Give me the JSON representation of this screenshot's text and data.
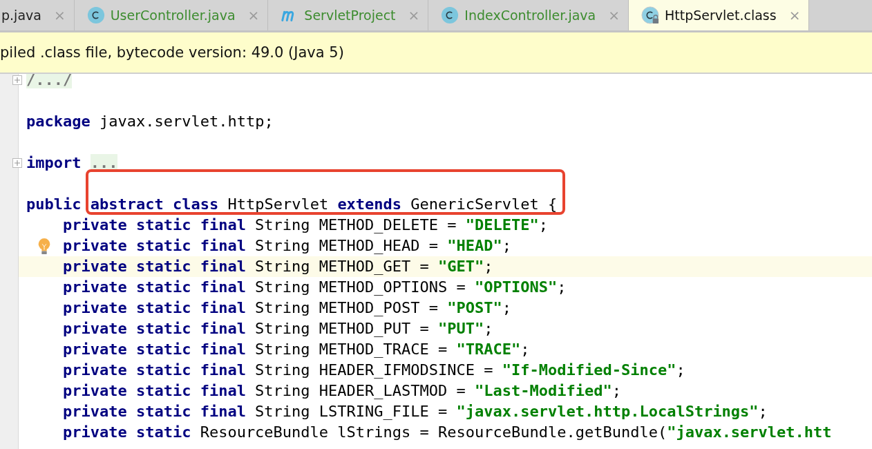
{
  "tabs": [
    {
      "label": "p.java",
      "kind": "plain",
      "close": "×",
      "color": "#222222",
      "selected": false
    },
    {
      "label": "UserController.java",
      "kind": "class",
      "close": "×",
      "color": "#3d8c2f",
      "selected": false
    },
    {
      "label": "ServletProject",
      "kind": "module",
      "close": "×",
      "color": "#3d8c2f",
      "selected": false
    },
    {
      "label": "IndexController.java",
      "kind": "class",
      "close": "×",
      "color": "#3d8c2f",
      "selected": false
    },
    {
      "label": "HttpServlet.class",
      "kind": "locked-class",
      "close": "×",
      "color": "#111111",
      "selected": true
    }
  ],
  "banner": {
    "text": "piled .class file, bytecode version: 49.0 (Java 5)"
  },
  "code_lines": [
    {
      "kind": "code",
      "fold": true,
      "tokens": [
        {
          "kind": "folded",
          "text": "/.../"
        }
      ]
    },
    {
      "kind": "blank"
    },
    {
      "kind": "code",
      "tokens": [
        {
          "kind": "keyword",
          "text": "package"
        },
        {
          "kind": "plain",
          "text": " javax.servlet.http;"
        }
      ]
    },
    {
      "kind": "blank"
    },
    {
      "kind": "code",
      "fold": true,
      "tokens": [
        {
          "kind": "keyword",
          "text": "import"
        },
        {
          "kind": "folded",
          "text": "..."
        }
      ]
    },
    {
      "kind": "blank"
    },
    {
      "kind": "code",
      "tokens": [
        {
          "kind": "keyword",
          "text": "public"
        },
        {
          "kind": "keyword",
          "text": "abstract",
          "boxed": true
        },
        {
          "kind": "keyword",
          "text": " class",
          "boxed": true
        },
        {
          "kind": "plain",
          "text": " HttpServlet ",
          "boxed": true
        },
        {
          "kind": "keyword",
          "text": "extends",
          "boxed": true
        },
        {
          "kind": "plain",
          "text": " GenericServlet {",
          "boxed": true
        }
      ]
    },
    {
      "kind": "code",
      "indented": true,
      "tokens": [
        {
          "kind": "keyword",
          "text": "private static final"
        },
        {
          "kind": "plain",
          "text": " String METHOD_DELETE = "
        },
        {
          "kind": "string",
          "text": "\"DELETE\""
        },
        {
          "kind": "plain",
          "text": ";"
        }
      ]
    },
    {
      "kind": "code",
      "indented": true,
      "bulb": true,
      "tokens": [
        {
          "kind": "keyword",
          "text": "private static final"
        },
        {
          "kind": "plain",
          "text": " String METHOD_HEAD = "
        },
        {
          "kind": "string",
          "text": "\"HEAD\""
        },
        {
          "kind": "plain",
          "text": ";"
        }
      ]
    },
    {
      "kind": "code",
      "indented": true,
      "current": true,
      "tokens": [
        {
          "kind": "keyword",
          "text": "private static final"
        },
        {
          "kind": "plain",
          "text": " String METHOD_GET = "
        },
        {
          "kind": "string",
          "text": "\"GET\""
        },
        {
          "kind": "plain",
          "text": ";"
        }
      ]
    },
    {
      "kind": "code",
      "indented": true,
      "tokens": [
        {
          "kind": "keyword",
          "text": "private static final"
        },
        {
          "kind": "plain",
          "text": " String METHOD_OPTIONS = "
        },
        {
          "kind": "string",
          "text": "\"OPTIONS\""
        },
        {
          "kind": "plain",
          "text": ";"
        }
      ]
    },
    {
      "kind": "code",
      "indented": true,
      "tokens": [
        {
          "kind": "keyword",
          "text": "private static final"
        },
        {
          "kind": "plain",
          "text": " String METHOD_POST = "
        },
        {
          "kind": "string",
          "text": "\"POST\""
        },
        {
          "kind": "plain",
          "text": ";"
        }
      ]
    },
    {
      "kind": "code",
      "indented": true,
      "tokens": [
        {
          "kind": "keyword",
          "text": "private static final"
        },
        {
          "kind": "plain",
          "text": " String METHOD_PUT = "
        },
        {
          "kind": "string",
          "text": "\"PUT\""
        },
        {
          "kind": "plain",
          "text": ";"
        }
      ]
    },
    {
      "kind": "code",
      "indented": true,
      "tokens": [
        {
          "kind": "keyword",
          "text": "private static final"
        },
        {
          "kind": "plain",
          "text": " String METHOD_TRACE = "
        },
        {
          "kind": "string",
          "text": "\"TRACE\""
        },
        {
          "kind": "plain",
          "text": ";"
        }
      ]
    },
    {
      "kind": "code",
      "indented": true,
      "tokens": [
        {
          "kind": "keyword",
          "text": "private static final"
        },
        {
          "kind": "plain",
          "text": " String HEADER_IFMODSINCE = "
        },
        {
          "kind": "string",
          "text": "\"If-Modified-Since\""
        },
        {
          "kind": "plain",
          "text": ";"
        }
      ]
    },
    {
      "kind": "code",
      "indented": true,
      "tokens": [
        {
          "kind": "keyword",
          "text": "private static final"
        },
        {
          "kind": "plain",
          "text": " String HEADER_LASTMOD = "
        },
        {
          "kind": "string",
          "text": "\"Last-Modified\""
        },
        {
          "kind": "plain",
          "text": ";"
        }
      ]
    },
    {
      "kind": "code",
      "indented": true,
      "tokens": [
        {
          "kind": "keyword",
          "text": "private static final"
        },
        {
          "kind": "plain",
          "text": " String LSTRING_FILE = "
        },
        {
          "kind": "string",
          "text": "\"javax.servlet.http.LocalStrings\""
        },
        {
          "kind": "plain",
          "text": ";"
        }
      ]
    },
    {
      "kind": "code",
      "indented": true,
      "tokens": [
        {
          "kind": "keyword",
          "text": "private static"
        },
        {
          "kind": "plain",
          "text": " ResourceBundle lStrings = ResourceBundle.getBundle("
        },
        {
          "kind": "string",
          "text": "\"javax.servlet.htt"
        }
      ]
    }
  ]
}
